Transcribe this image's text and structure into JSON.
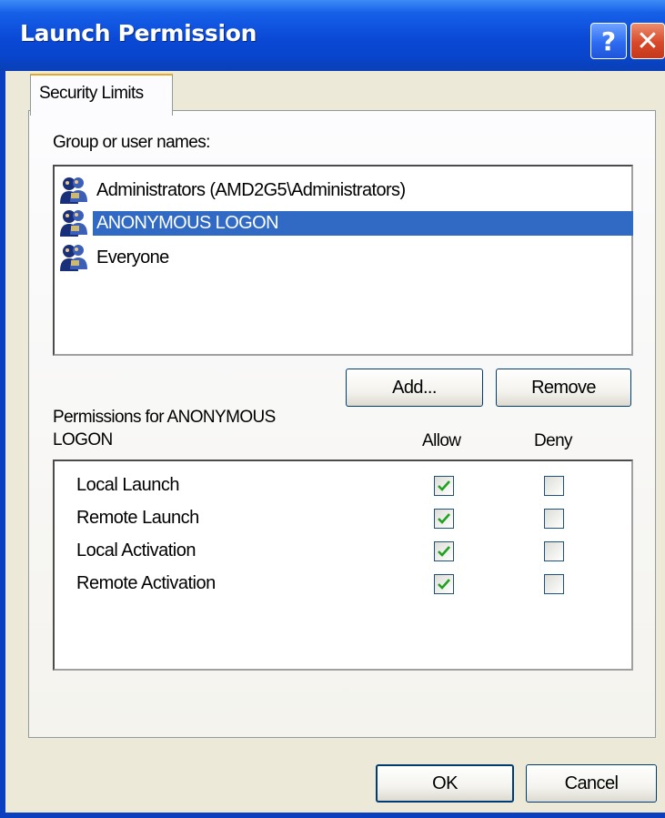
{
  "window": {
    "title": "Launch Permission"
  },
  "titlebar": {
    "help_glyph": "?",
    "close_glyph": "✕"
  },
  "tabs": [
    {
      "label": "Security Limits",
      "active": true
    }
  ],
  "groups": {
    "label": "Group or user names:",
    "users": [
      {
        "name": "Administrators (AMD2G5\\Administrators)",
        "icon": "users-group-icon",
        "selected": false
      },
      {
        "name": "ANONYMOUS LOGON",
        "icon": "users-group-icon",
        "selected": true
      },
      {
        "name": "Everyone",
        "icon": "users-group-icon",
        "selected": false
      }
    ]
  },
  "buttons": {
    "add": "Add...",
    "remove": "Remove",
    "ok": "OK",
    "cancel": "Cancel"
  },
  "permissions": {
    "label": "Permissions for ANONYMOUS LOGON",
    "allow_header": "Allow",
    "deny_header": "Deny",
    "rows": [
      {
        "name": "Local Launch",
        "allow": true,
        "deny": false
      },
      {
        "name": "Remote Launch",
        "allow": true,
        "deny": false
      },
      {
        "name": "Local Activation",
        "allow": true,
        "deny": false
      },
      {
        "name": "Remote Activation",
        "allow": true,
        "deny": false
      }
    ]
  },
  "colors": {
    "selection": "#316ac5",
    "dialog_face": "#ece9d8",
    "titlebar": "#0a49d6",
    "check": "#21a121"
  }
}
